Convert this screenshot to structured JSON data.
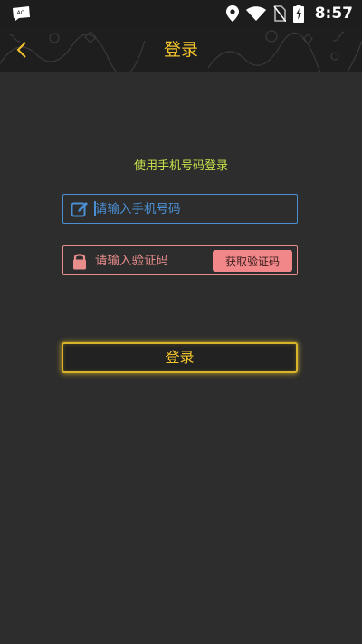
{
  "status_bar": {
    "time": "8:57",
    "icons": [
      "app-badge-icon",
      "location-icon",
      "wifi-icon",
      "no-sim-icon",
      "battery-charging-icon"
    ]
  },
  "header": {
    "title": "登录",
    "back_icon": "chevron-left-icon"
  },
  "form": {
    "subtitle": "使用手机号码登录",
    "phone_placeholder": "请输入手机号码",
    "phone_value": "",
    "code_placeholder": "请输入验证码",
    "code_value": "",
    "get_code_label": "获取验证码",
    "login_label": "登录"
  },
  "colors": {
    "accent": "#f2c32b",
    "phone_field": "#4b8fd3",
    "code_field": "#e88c8c",
    "subtitle": "#c6e24a",
    "background": "#2d2d2d"
  }
}
